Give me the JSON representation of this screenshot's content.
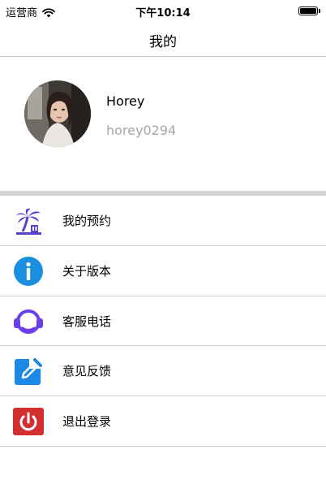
{
  "status_bar": {
    "carrier": "运营商",
    "time": "下午10:14"
  },
  "nav": {
    "title": "我的"
  },
  "profile": {
    "name": "Horey",
    "account": "horey0294"
  },
  "menu": {
    "items": [
      {
        "label": "我的预约",
        "icon": "palm-tree-icon"
      },
      {
        "label": "关于版本",
        "icon": "info-icon"
      },
      {
        "label": "客服电话",
        "icon": "headset-icon"
      },
      {
        "label": "意见反馈",
        "icon": "edit-icon"
      },
      {
        "label": "退出登录",
        "icon": "power-icon"
      }
    ]
  },
  "colors": {
    "palm": "#5b3fd1",
    "info": "#1a8fe0",
    "headset": "#6a3ee8",
    "edit": "#1e88e5",
    "power": "#d32f2f",
    "divider": "#d4d4d4",
    "secondary_text": "#a6a6a6"
  }
}
